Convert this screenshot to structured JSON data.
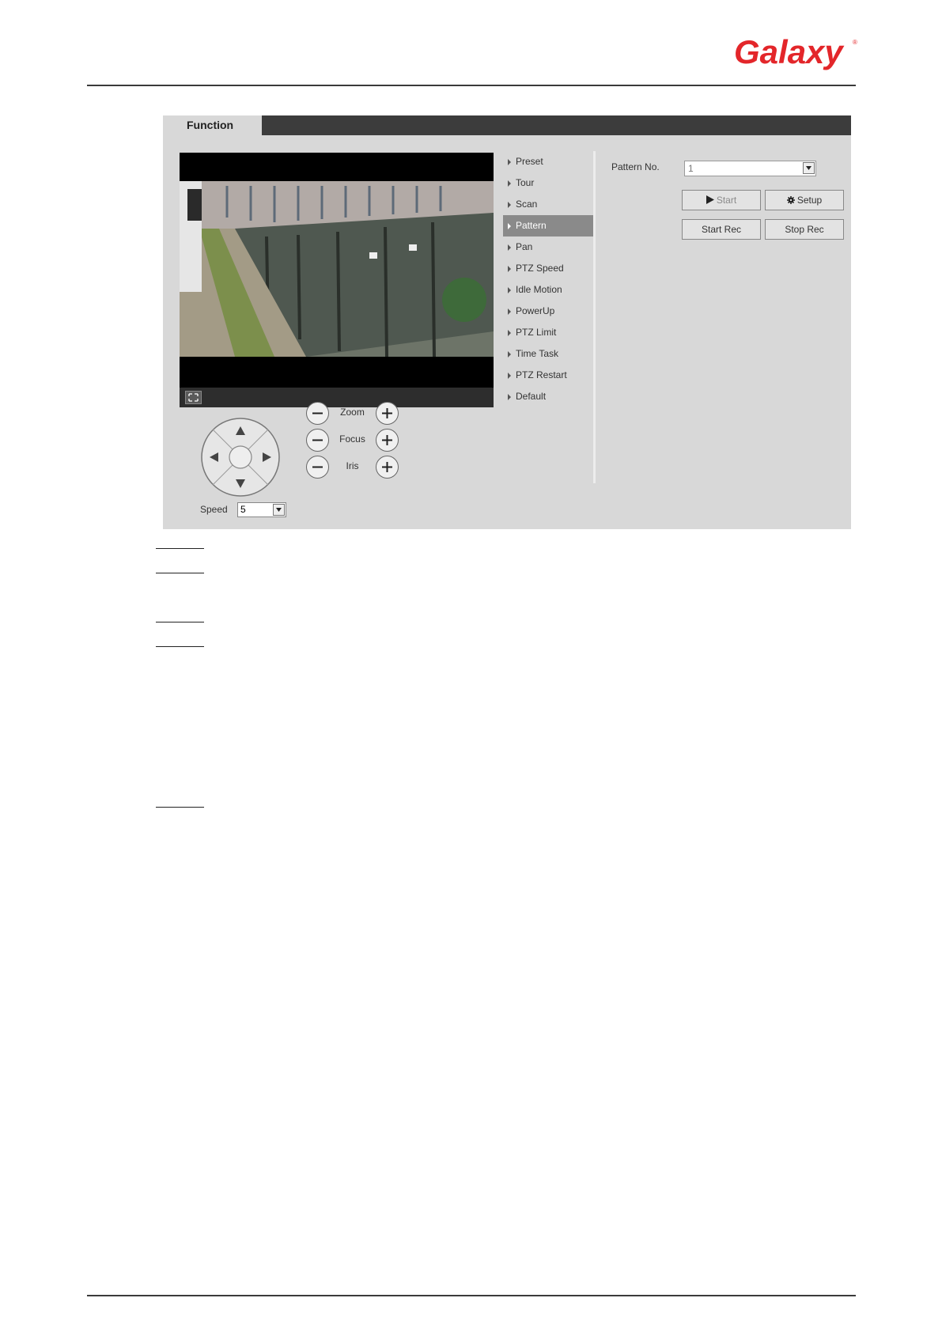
{
  "header": {
    "logo_text": "Galaxy"
  },
  "ui": {
    "tab_title": "Function",
    "speed_label": "Speed",
    "speed_value": "5",
    "zoom_label": "Zoom",
    "focus_label": "Focus",
    "iris_label": "Iris",
    "menu": [
      {
        "label": "Preset",
        "active": false
      },
      {
        "label": "Tour",
        "active": false
      },
      {
        "label": "Scan",
        "active": false
      },
      {
        "label": "Pattern",
        "active": true
      },
      {
        "label": "Pan",
        "active": false
      },
      {
        "label": "PTZ Speed",
        "active": false
      },
      {
        "label": "Idle Motion",
        "active": false
      },
      {
        "label": "PowerUp",
        "active": false
      },
      {
        "label": "PTZ Limit",
        "active": false
      },
      {
        "label": "Time Task",
        "active": false
      },
      {
        "label": "PTZ Restart",
        "active": false
      },
      {
        "label": "Default",
        "active": false
      }
    ],
    "pattern_no_label": "Pattern No.",
    "pattern_no_value": "1",
    "start_label": "Start",
    "setup_label": "Setup",
    "start_rec_label": "Start Rec",
    "stop_rec_label": "Stop Rec"
  },
  "colors": {
    "brand": "#e3262a",
    "active_menu": "#8a8a8a",
    "tab_bar": "#3c3c3c",
    "panel": "#d8d8d8"
  }
}
